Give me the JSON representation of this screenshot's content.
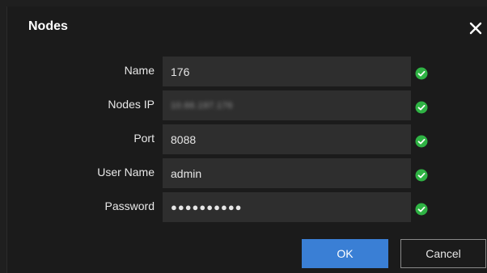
{
  "dialog": {
    "title": "Nodes",
    "close_icon": "close-icon"
  },
  "form": {
    "fields": [
      {
        "label": "Name",
        "value": "176",
        "status_icon": "check-circle-icon"
      },
      {
        "label": "Nodes IP",
        "value": "10.66.197.176",
        "status_icon": "check-circle-icon"
      },
      {
        "label": "Port",
        "value": "8088",
        "status_icon": "check-circle-icon"
      },
      {
        "label": "User Name",
        "value": "admin",
        "status_icon": "check-circle-icon"
      },
      {
        "label": "Password",
        "value": "●●●●●●●●●●",
        "status_icon": "check-circle-icon"
      }
    ]
  },
  "buttons": {
    "ok_label": "OK",
    "cancel_label": "Cancel"
  },
  "colors": {
    "background": "#1b1b1b",
    "field_bg": "#2e2e2e",
    "accent": "#3a7fd5",
    "success": "#2fb344"
  }
}
